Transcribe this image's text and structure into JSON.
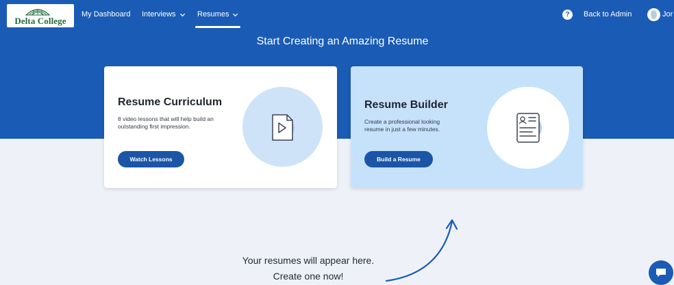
{
  "header": {
    "logo": {
      "text": "Delta College",
      "brand_color": "#1e6b3a"
    },
    "nav": [
      {
        "label": "My Dashboard",
        "has_dropdown": false,
        "active": false
      },
      {
        "label": "Interviews",
        "has_dropdown": true,
        "active": false
      },
      {
        "label": "Resumes",
        "has_dropdown": true,
        "active": true
      }
    ],
    "help_icon": "?",
    "back_to_admin": "Back to Admin",
    "user_name": "Jor"
  },
  "hero": {
    "title": "Start Creating an Amazing Resume"
  },
  "cards": [
    {
      "title": "Resume Curriculum",
      "description": "8 video lessons that will help build an outstanding first impression.",
      "button": "Watch Lessons",
      "icon": "video-play-icon"
    },
    {
      "title": "Resume Builder",
      "description": "Create a professional looking resume in just a few minutes.",
      "button": "Build a Resume",
      "icon": "resume-document-icon"
    }
  ],
  "empty_state": {
    "line1": "Your resumes will appear here.",
    "line2": "Create one now!"
  },
  "colors": {
    "primary": "#1a5cb5",
    "button": "#1b55a6",
    "page_bg": "#eef2f8",
    "builder_card_bg": "#c6e2fb"
  },
  "chat_icon": "chat-bubble-icon"
}
